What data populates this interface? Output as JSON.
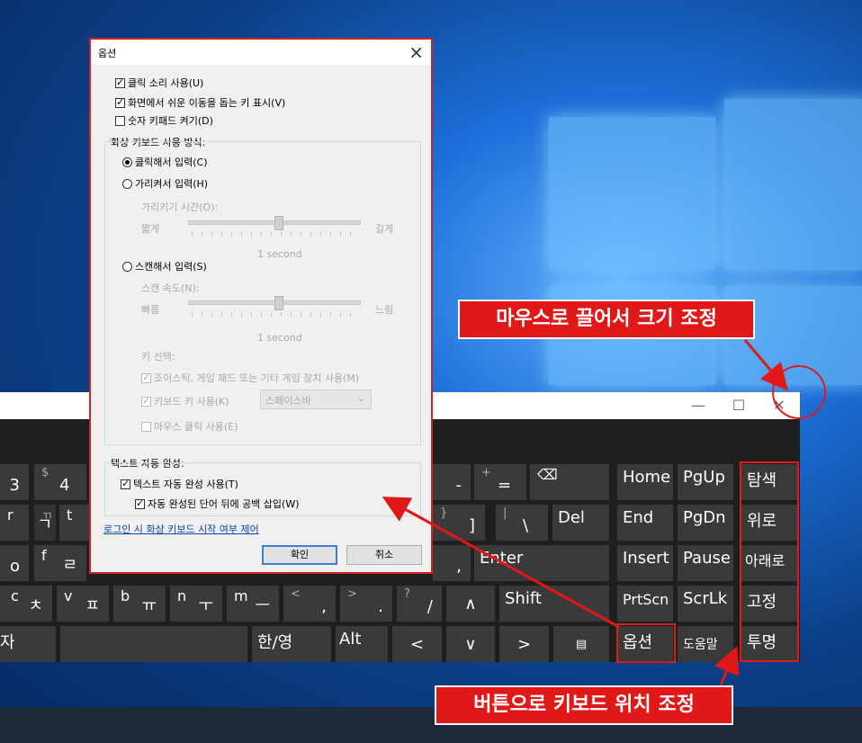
{
  "dialog": {
    "title": "옵션",
    "opt_click_sound": "클릭 소리 사용(U)",
    "opt_nav_keys": "화면에서 쉬운 이동을 돕는 키 표시(V)",
    "opt_numpad": "숫자 키패드 켜기(D)",
    "usage_group": "화상 키보드 사용 방식:",
    "mode_click": "클릭해서 입력(C)",
    "mode_hover": "가리켜서 입력(H)",
    "hover_time": "가리키기 시간(O):",
    "hover_short": "짧게",
    "hover_long": "길게",
    "hover_value": "1 second",
    "mode_scan": "스캔해서 입력(S)",
    "scan_speed": "스캔 속도(N):",
    "scan_fast": "빠름",
    "scan_slow": "느림",
    "scan_value": "1 second",
    "key_select": "키 선택:",
    "opt_joystick": "조이스틱, 게임 패드 또는 기타 게임 장치 사용(M)",
    "opt_keyboard_key": "키보드 키 사용(K)",
    "keyboard_key_value": "스페이스바",
    "opt_mouse_click": "마우스 클릭 사용(E)",
    "text_group": "텍스트 자동 완성:",
    "opt_text_predict": "텍스트 자동 완성 사용(T)",
    "opt_space_after": "자동 완성된 단어 뒤에 공백 삽입(W)",
    "link_startup": "로그인 시 화상 키보드 시작 여부 제어",
    "ok": "확인",
    "cancel": "취소"
  },
  "osk": {
    "minimize": "—",
    "maximize": "☐",
    "close": "✕",
    "row1": {
      "k3": "3",
      "dollar": "$",
      "k4": "4",
      "minus": "-",
      "plus": "+",
      "equal": "=",
      "backspace": "⌫",
      "home": "Home",
      "pgup": "PgUp",
      "nav": "탐색"
    },
    "row2": {
      "r": "r",
      "rh": "ㄲ",
      "rh2": "ㄱ",
      "t": "t",
      "brace": "}",
      "bracket": "]",
      "pipe": "|",
      "backslash": "\\",
      "del": "Del",
      "end": "End",
      "pgdn": "PgDn",
      "up": "위로"
    },
    "row3": {
      "o": "o",
      "f": "f",
      "fh": "ㄹ",
      "comma": ",",
      "enter": "Enter",
      "insert": "Insert",
      "pause": "Pause",
      "down": "아래로"
    },
    "row4": {
      "c": "c",
      "ch": "ㅊ",
      "v": "v",
      "vh": "ㅍ",
      "b": "b",
      "bh": "ㅠ",
      "n": "n",
      "nh": "ㅜ",
      "m": "m",
      "mh": "ㅡ",
      "lt": "<",
      "comma2": ",",
      "gt": ">",
      "dot": ".",
      "q": "?",
      "slash": "/",
      "uparrow": "∧",
      "shift": "Shift",
      "prtscn": "PrtScn",
      "scrlk": "ScrLk",
      "dock": "고정"
    },
    "row5": {
      "ja": "자",
      "hanyoung": "한/영",
      "alt": "Alt",
      "left": "<",
      "downarrow": "∨",
      "right": ">",
      "menu": "▤",
      "options": "옵션",
      "help": "도움말",
      "fade": "투명"
    }
  },
  "annotations": {
    "resize": "마우스로 끌어서 크기 조정",
    "move": "버튼으로 키보드 위치 조정"
  }
}
